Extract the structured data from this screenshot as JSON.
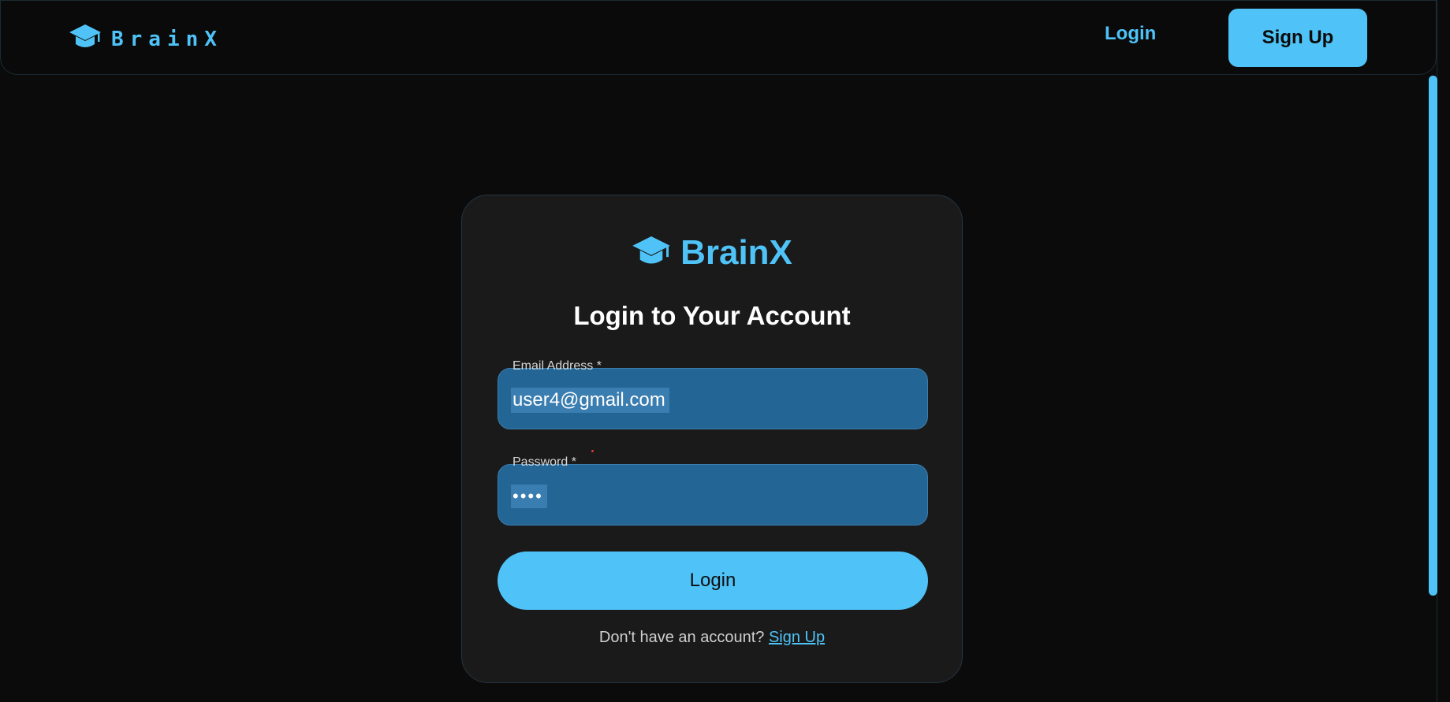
{
  "navbar": {
    "brand": "BrainX",
    "brand_icon": "graduation-cap-icon",
    "login_label": "Login",
    "signup_label": "Sign Up"
  },
  "card": {
    "brand": "BrainX",
    "brand_icon": "graduation-cap-icon",
    "title": "Login to Your Account",
    "email": {
      "label": "Email Address *",
      "value": "user4@gmail.com"
    },
    "password": {
      "label": "Password *",
      "value": "••••"
    },
    "login_button": "Login",
    "footer_prompt": "Don't have an account?",
    "footer_link": "Sign Up"
  },
  "colors": {
    "accent": "#4fc3f7",
    "background": "#0b0b0b",
    "card": "#1a1a1a",
    "input": "#236594"
  }
}
